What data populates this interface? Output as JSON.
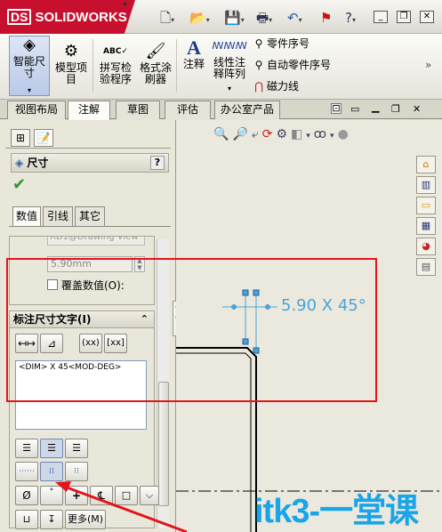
{
  "app": {
    "logo_text": "SOLIDWORKS",
    "logo_mark": "DS"
  },
  "quick_access": {
    "new_icon": "new-document-icon",
    "open_icon": "open-folder-icon",
    "save_icon": "save-icon",
    "print_icon": "print-icon",
    "undo_icon": "undo-icon",
    "rebuild_icon": "traffic-light-icon",
    "help_label": "?"
  },
  "ribbon": {
    "smart_dimension": "智能尺寸",
    "model_items": "模型项目",
    "spell_checker": "拼写检验程序",
    "format_painter": "格式涂刷器",
    "note": "注释",
    "linear_note_pattern": "线性注释阵列",
    "balloon": "零件序号",
    "auto_balloon": "自动零件序号",
    "magnetic_line": "磁力线",
    "abc": "ABC"
  },
  "command_tabs": [
    "视图布局",
    "注解",
    "草图",
    "评估",
    "办公室产品"
  ],
  "property_manager": {
    "title": "尺寸",
    "help": "?",
    "sub_tabs": [
      "数值",
      "引线",
      "其它"
    ],
    "ref_value_text": "RD1@Drawing View",
    "dim_value": "5.90mm",
    "override_label": "覆盖数值(O):",
    "text_section_title": "标注尺寸文字(I)",
    "dim_text_field": "<DIM> X 45<MOD-DEG>",
    "more_button": "更多(M)",
    "paren_label": "(xx)",
    "bracket_label": "[xx]",
    "diameter_symbol": "Ø",
    "degree_symbol": "°",
    "plus_minus_symbol": "+",
    "centerline_symbol": "℄"
  },
  "drawing": {
    "dimension_label": "5.90 X 45°"
  },
  "watermark": "itk3-一堂课"
}
